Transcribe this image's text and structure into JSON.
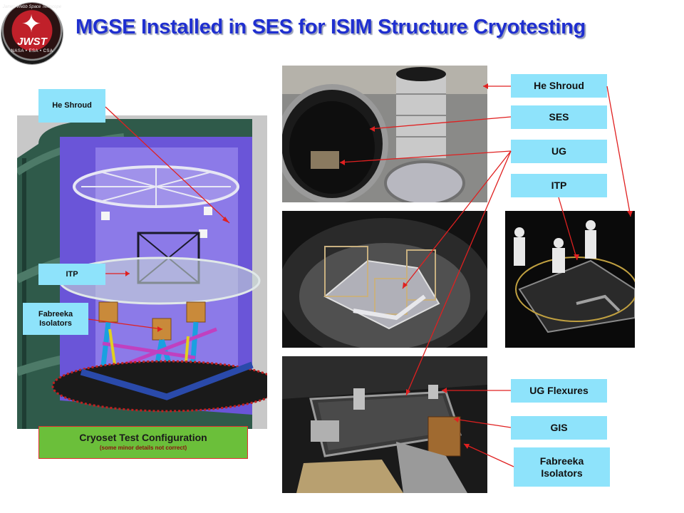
{
  "title": "MGSE Installed in SES for ISIM Structure Cryotesting",
  "logo": {
    "text": "JWST",
    "ring_text": "James Webb Space Telescope",
    "sub_text": "NASA • ESA • CSA"
  },
  "drawing_labels": {
    "he_shroud": "He Shroud",
    "itp": "ITP",
    "fabreeka": "Fabreeka Isolators"
  },
  "caption": {
    "title": "Cryoset Test Configuration",
    "subtitle": "(some minor details not correct)"
  },
  "photo_labels": {
    "he_shroud": "He Shroud",
    "ses": "SES",
    "ug": "UG",
    "itp": "ITP",
    "ug_flexures": "UG Flexures",
    "gis": "GIS",
    "fabreeka": "Fabreeka Isolators"
  },
  "colors": {
    "title": "#1f2fd0",
    "label_bg": "#8ee3fb",
    "caption_bg": "#6bbf3a",
    "leader_line": "#e02020"
  }
}
